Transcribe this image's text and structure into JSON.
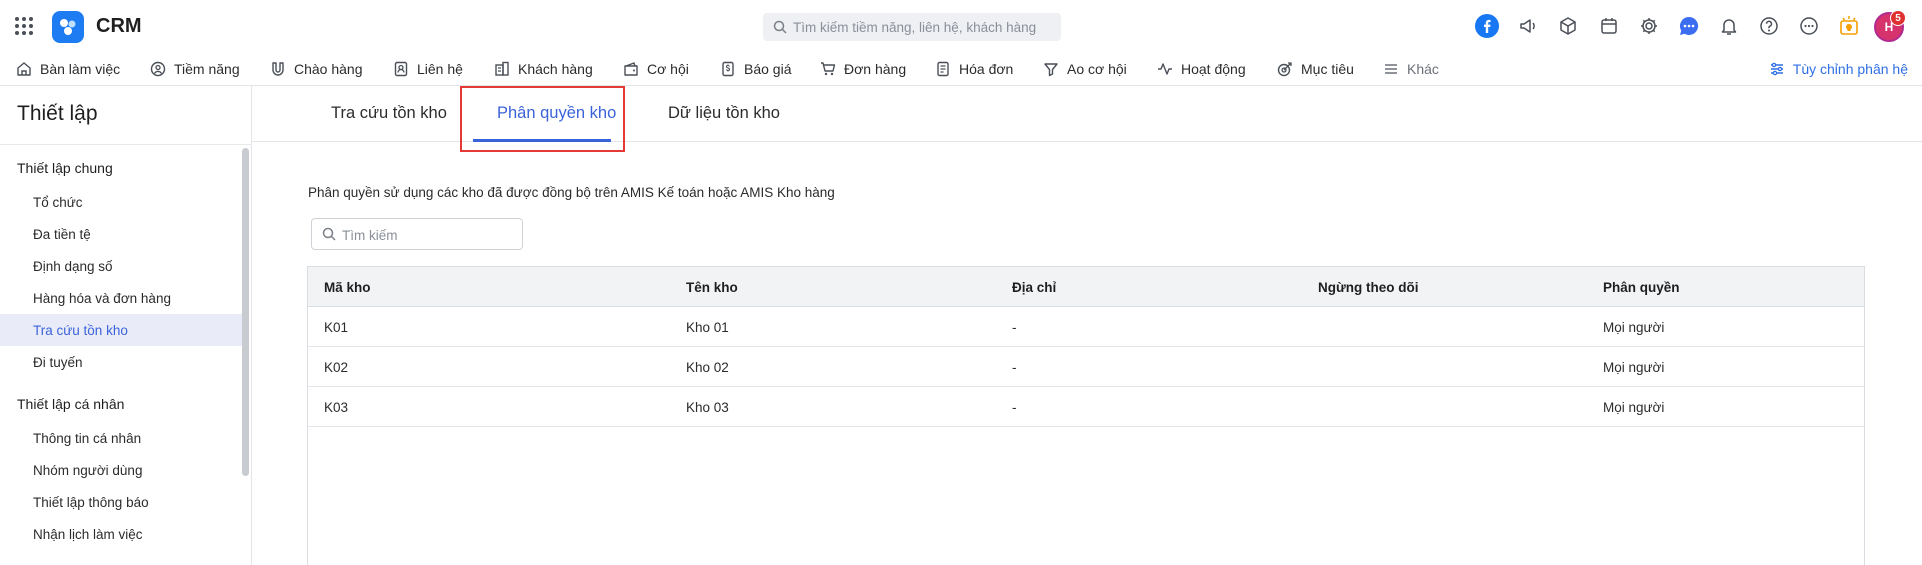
{
  "app": {
    "brand": "CRM"
  },
  "top_search": {
    "placeholder": "Tìm kiếm tiềm năng, liên hệ, khách hàng"
  },
  "user": {
    "initials": "H",
    "notification_count": "5"
  },
  "nav": {
    "items": [
      {
        "label": "Bàn làm việc",
        "icon": "home-icon"
      },
      {
        "label": "Tiềm năng",
        "icon": "lead-icon"
      },
      {
        "label": "Chào hàng",
        "icon": "magnet-icon"
      },
      {
        "label": "Liên hệ",
        "icon": "contact-icon"
      },
      {
        "label": "Khách hàng",
        "icon": "building-icon"
      },
      {
        "label": "Cơ hội",
        "icon": "wallet-icon"
      },
      {
        "label": "Báo giá",
        "icon": "quote-icon"
      },
      {
        "label": "Đơn hàng",
        "icon": "cart-icon"
      },
      {
        "label": "Hóa đơn",
        "icon": "invoice-icon"
      },
      {
        "label": "Ao cơ hội",
        "icon": "funnel-icon"
      },
      {
        "label": "Hoạt động",
        "icon": "activity-icon"
      },
      {
        "label": "Mục tiêu",
        "icon": "target-icon"
      },
      {
        "label": "Khác",
        "icon": "menu-icon"
      }
    ],
    "customize_label": "Tùy chỉnh phân hệ"
  },
  "sidebar": {
    "title": "Thiết lập",
    "groups": [
      {
        "label": "Thiết lập chung",
        "items": [
          "Tổ chức",
          "Đa tiền tệ",
          "Định dạng số",
          "Hàng hóa và đơn hàng",
          "Tra cứu tồn kho",
          "Đi tuyến"
        ]
      },
      {
        "label": "Thiết lập cá nhân",
        "items": [
          "Thông tin cá nhân",
          "Nhóm người dùng",
          "Thiết lập thông báo",
          "Nhận lịch làm việc"
        ]
      }
    ],
    "active_item": "Tra cứu tồn kho"
  },
  "tabs": [
    {
      "label": "Tra cứu tồn kho"
    },
    {
      "label": "Phân quyền kho"
    },
    {
      "label": "Dữ liệu tồn kho"
    }
  ],
  "active_tab": "Phân quyền kho",
  "content": {
    "description": "Phân quyền sử dụng các kho đã được đồng bộ trên AMIS Kế toán hoặc AMIS Kho hàng",
    "search_placeholder": "Tìm kiếm"
  },
  "table": {
    "columns": [
      "Mã kho",
      "Tên kho",
      "Địa chỉ",
      "Ngừng theo dõi",
      "Phân quyền"
    ],
    "rows": [
      [
        "K01",
        "Kho 01",
        "-",
        "",
        "Mọi người"
      ],
      [
        "K02",
        "Kho 02",
        "-",
        "",
        "Mọi người"
      ],
      [
        "K03",
        "Kho 03",
        "-",
        "",
        "Mọi người"
      ]
    ]
  },
  "colors": {
    "accent": "#3b63d9",
    "highlight": "#e53935",
    "facebook": "#1877f2",
    "brand": "#1e7cf2"
  }
}
